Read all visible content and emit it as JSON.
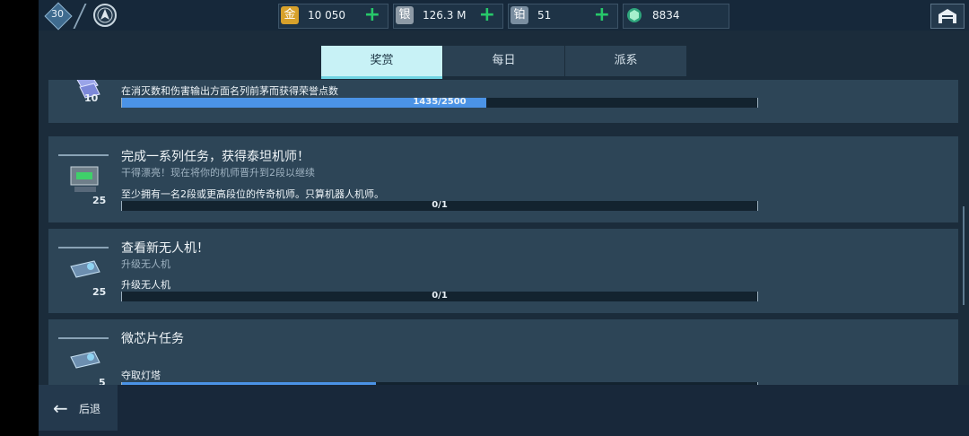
{
  "header": {
    "level": "30",
    "currencies": [
      {
        "icon": "金",
        "value": "10 050",
        "color": "#d7a12b"
      },
      {
        "icon": "银",
        "value": "126.3 M",
        "color": "#8d9aa6"
      },
      {
        "icon": "铂",
        "value": "51",
        "color": "#7a8ea0"
      },
      {
        "icon": "gem-icon",
        "value": "8834",
        "color": "#2fa57c"
      }
    ]
  },
  "tabs": [
    "奖赏",
    "每日",
    "派系"
  ],
  "active_tab": "奖赏",
  "tasks": [
    {
      "reward": "10",
      "title": "",
      "subtitle": "",
      "requirement": "在消灭数和伤害输出方面名列前茅而获得荣誉点数",
      "progress_text": "1435/2500",
      "progress": 0.574
    },
    {
      "reward": "25",
      "title": "完成一系列任务，获得泰坦机师！",
      "subtitle": "干得漂亮！现在将你的机师晋升到2段以继续",
      "requirement": "至少拥有一名2段或更高段位的传奇机师。只算机器人机师。",
      "progress_text": "0/1",
      "progress": 0
    },
    {
      "reward": "25",
      "title": "查看新无人机！",
      "subtitle": "升级无人机",
      "requirement": "升级无人机",
      "progress_text": "0/1",
      "progress": 0
    },
    {
      "reward": "5",
      "title": "微芯片任务",
      "subtitle": "",
      "requirement": "夺取灯塔",
      "progress_text": "",
      "progress": 0.4
    }
  ],
  "back_label": "后退",
  "colors": {
    "accent_tab": "#c8f2f6",
    "progress_fill": "#4b93e6",
    "plus": "#27c96a"
  }
}
